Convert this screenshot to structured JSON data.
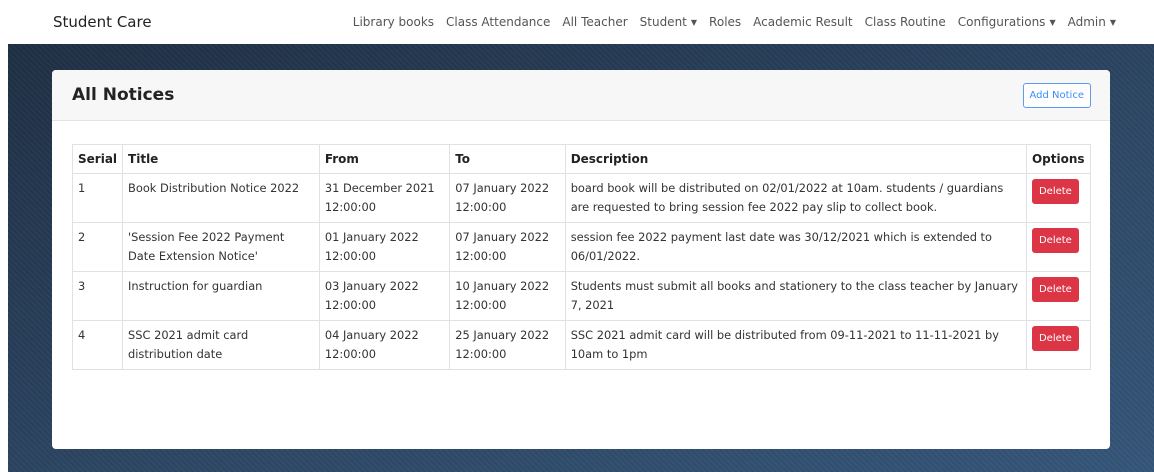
{
  "navbar": {
    "brand": "Student Care",
    "items": [
      {
        "label": "Library books"
      },
      {
        "label": "Class Attendance"
      },
      {
        "label": "All Teacher"
      },
      {
        "label": "Student",
        "dropdown": true
      },
      {
        "label": "Roles"
      },
      {
        "label": "Academic Result"
      },
      {
        "label": "Class Routine"
      },
      {
        "label": "Configurations",
        "dropdown": true
      },
      {
        "label": "Admin",
        "dropdown": true
      }
    ]
  },
  "card": {
    "title": "All Notices",
    "add_button": "Add Notice"
  },
  "table": {
    "headers": [
      "Serial",
      "Title",
      "From",
      "To",
      "Description",
      "Options"
    ],
    "rows": [
      {
        "serial": "1",
        "title": "Book Distribution Notice 2022",
        "from": "31 December 2021 12:00:00",
        "to": "07 January 2022 12:00:00",
        "description": "board book will be distributed on 02/01/2022 at 10am. students / guardians are requested to bring session fee 2022 pay slip to collect book.",
        "action": "Delete"
      },
      {
        "serial": "2",
        "title": "'Session Fee 2022 Payment Date Extension Notice'",
        "from": "01 January 2022 12:00:00",
        "to": "07 January 2022 12:00:00",
        "description": "session fee 2022 payment last date was 30/12/2021 which is extended to 06/01/2022.",
        "action": "Delete"
      },
      {
        "serial": "3",
        "title": "Instruction for guardian",
        "from": "03 January 2022 12:00:00",
        "to": "10 January 2022 12:00:00",
        "description": "Students must submit all books and stationery to the class teacher by January 7, 2021",
        "action": "Delete"
      },
      {
        "serial": "4",
        "title": "SSC 2021 admit card distribution date",
        "from": "04 January 2022 12:00:00",
        "to": "25 January 2022 12:00:00",
        "description": "SSC 2021 admit card will be distributed from 09-11-2021 to 11-11-2021 by 10am to 1pm",
        "action": "Delete"
      }
    ]
  },
  "colors": {
    "danger": "#dc3545",
    "primary": "#3d8bfd",
    "background_dark": "#2c4663"
  }
}
